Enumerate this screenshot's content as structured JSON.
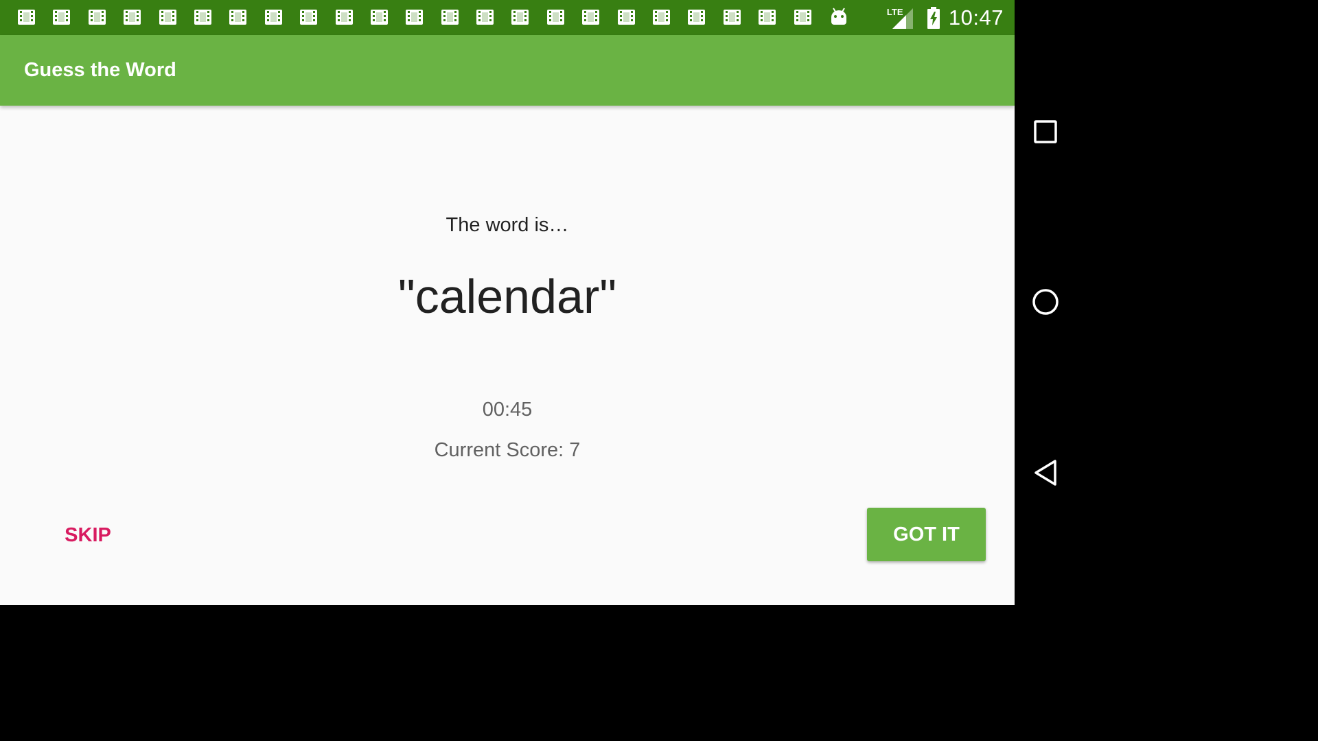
{
  "status_bar": {
    "time": "10:47",
    "network_label": "LTE",
    "notification_icons": [
      "film-icon",
      "film-icon",
      "film-icon",
      "film-icon",
      "film-icon",
      "film-icon",
      "film-icon",
      "film-icon",
      "film-icon",
      "film-icon",
      "film-icon",
      "film-icon",
      "film-icon",
      "film-icon",
      "film-icon",
      "film-icon",
      "film-icon",
      "film-icon",
      "film-icon",
      "film-icon",
      "film-icon",
      "film-icon",
      "film-icon",
      "android-icon"
    ],
    "colors": {
      "background": "#387f12"
    }
  },
  "app_bar": {
    "title": "Guess the Word",
    "colors": {
      "background": "#6ab344"
    }
  },
  "game": {
    "prompt": "The word is…",
    "word": "\"calendar\"",
    "timer": "00:45",
    "score_text": "Current Score: 7"
  },
  "actions": {
    "skip_label": "SKIP",
    "got_it_label": "GOT IT",
    "colors": {
      "skip": "#d81b60",
      "got_it": "#6ab344"
    }
  },
  "nav_bar": {
    "buttons": [
      "recents-icon",
      "home-icon",
      "back-icon"
    ]
  }
}
